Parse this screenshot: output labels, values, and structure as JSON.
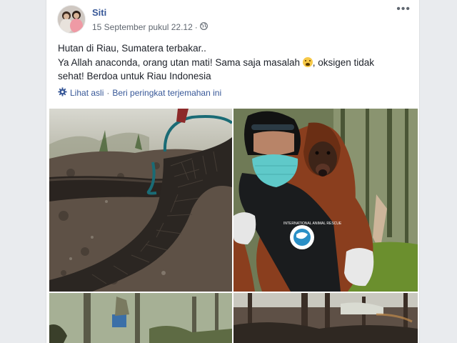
{
  "post": {
    "author": "Siti",
    "timestamp": "15 September pukul 22.12",
    "privacy_icon": "globe-icon",
    "more_icon": "more-options-icon",
    "more_symbol": "•••",
    "text_lines": [
      "Hutan di Riau, Sumatera terbakar..",
      "Ya Allah anaconda, orang utan mati! Sama saja masalah",
      ", oksigen tidak",
      "sehat! Berdoa untuk Riau Indonesia"
    ],
    "translation": {
      "icon": "gear-icon",
      "view_original": "Lihat asli",
      "separator": "·",
      "rate_translation": "Beri peringkat terjemahan ini"
    },
    "photos": [
      {
        "name": "burnt-anaconda-photo"
      },
      {
        "name": "orangutan-rescue-photo"
      },
      {
        "name": "smoky-forest-photo"
      },
      {
        "name": "burnt-forest-photo"
      }
    ],
    "rescuer_shirt_text": "INTERNATIONAL ANIMAL RESCUE"
  }
}
